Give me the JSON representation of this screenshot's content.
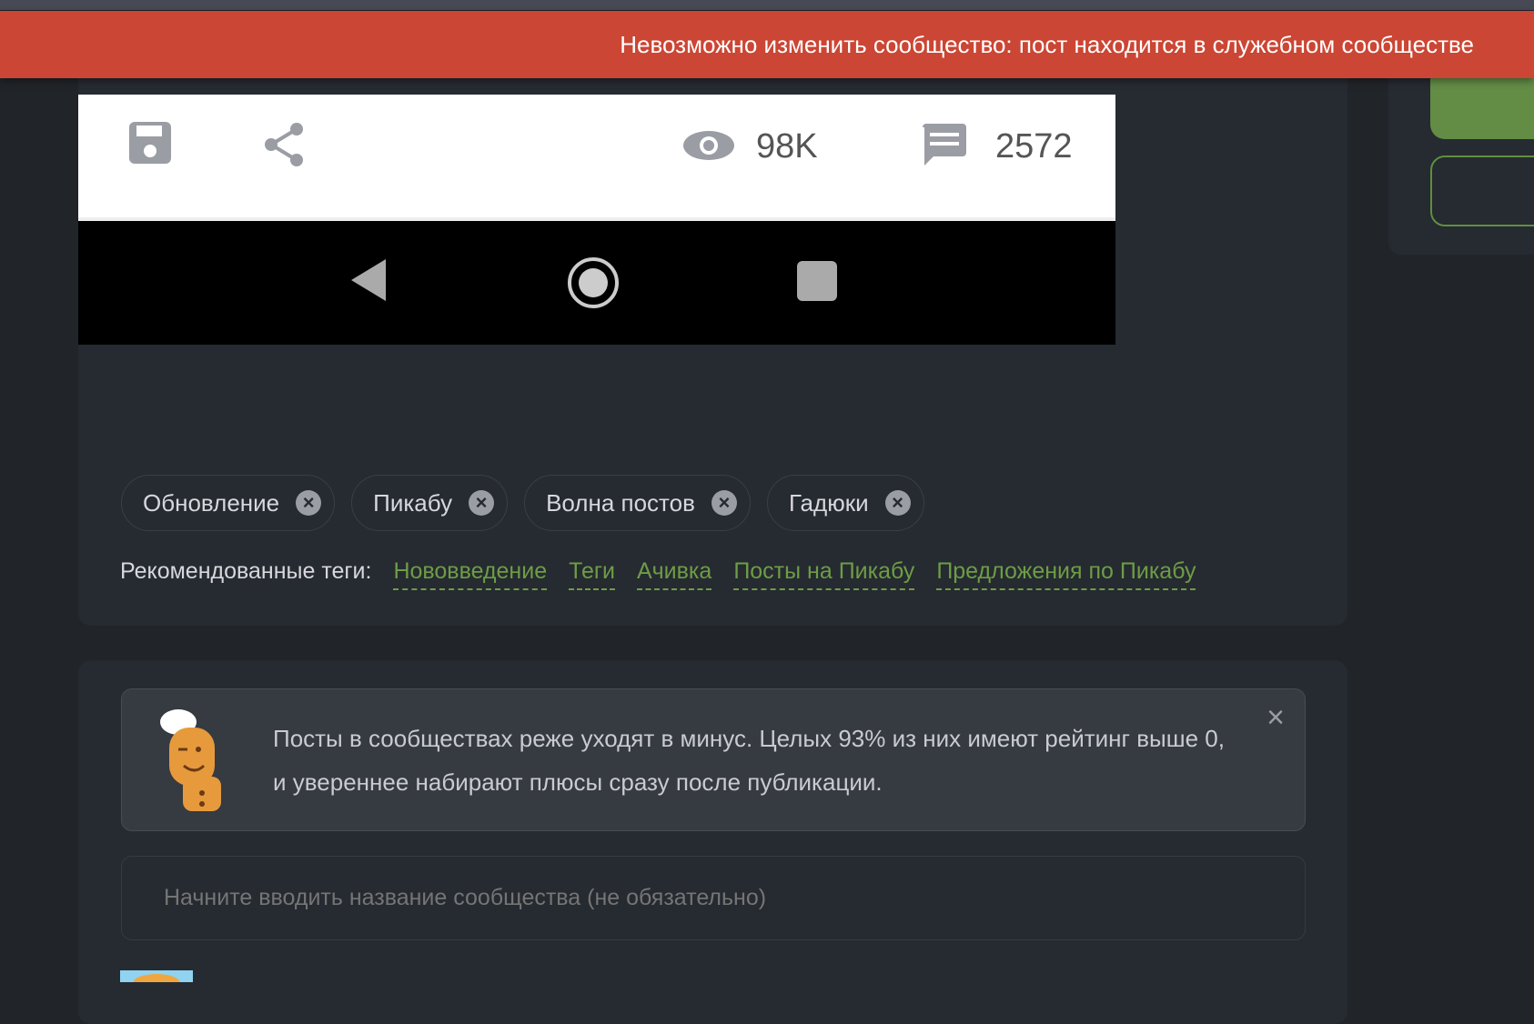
{
  "banner": {
    "message": "Невозможно изменить сообщество: пост находится в служебном сообществе"
  },
  "screenshot": {
    "views": "98K",
    "comments": "2572"
  },
  "tags": [
    {
      "label": "Обновление"
    },
    {
      "label": "Пикабу"
    },
    {
      "label": "Волна постов"
    },
    {
      "label": "Гадюки"
    }
  ],
  "recommended": {
    "label": "Рекомендованные теги:",
    "items": [
      "Нововведение",
      "Теги",
      "Ачивка",
      "Посты на Пикабу",
      "Предложения по Пикабу"
    ]
  },
  "tip": {
    "text": "Посты в сообществах реже уходят в минус. Целых 93% из них имеют рейтинг выше 0, и увереннее набирают плюсы сразу после публикации."
  },
  "community": {
    "placeholder": "Начните вводить название сообщества (не обязательно)"
  },
  "colors": {
    "banner": "#cb4634",
    "accent": "#6d9d45"
  }
}
